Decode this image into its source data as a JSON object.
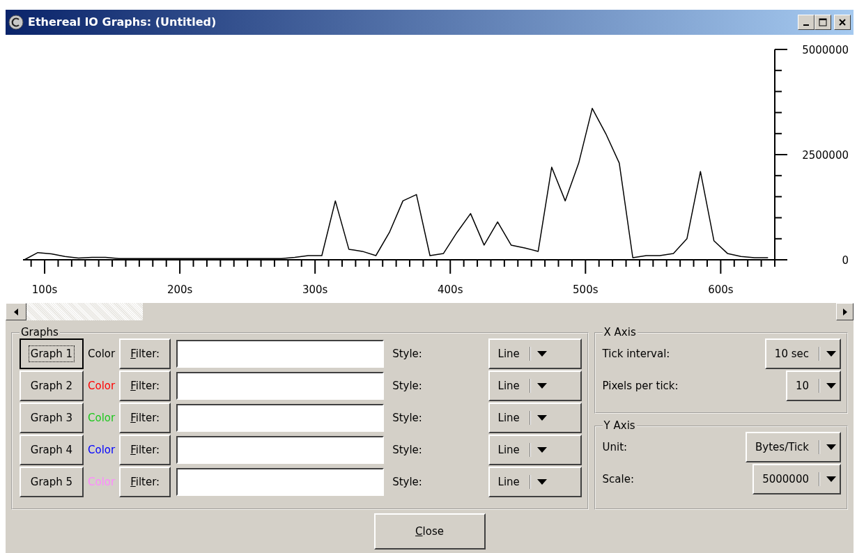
{
  "window": {
    "title": "Ethereal IO Graphs: (Untitled)"
  },
  "chart": {
    "chart_data": {
      "type": "line",
      "xlim": [
        84,
        640
      ],
      "ylim": [
        0,
        5000000
      ],
      "xticks": [
        {
          "value": 100,
          "label": "100s"
        },
        {
          "value": 200,
          "label": "200s"
        },
        {
          "value": 300,
          "label": "300s"
        },
        {
          "value": 400,
          "label": "400s"
        },
        {
          "value": 500,
          "label": "500s"
        },
        {
          "value": 600,
          "label": "600s"
        }
      ],
      "yticks": [
        {
          "value": 0,
          "label": "0"
        },
        {
          "value": 2500000,
          "label": "2500000"
        },
        {
          "value": 5000000,
          "label": "5000000"
        }
      ],
      "x": [
        85,
        95,
        105,
        115,
        125,
        135,
        145,
        155,
        165,
        175,
        185,
        195,
        205,
        215,
        225,
        235,
        245,
        255,
        265,
        275,
        285,
        295,
        305,
        315,
        325,
        335,
        345,
        355,
        365,
        375,
        385,
        395,
        405,
        415,
        425,
        435,
        445,
        455,
        465,
        475,
        485,
        495,
        505,
        515,
        525,
        535,
        545,
        555,
        565,
        575,
        585,
        595,
        605,
        615,
        625,
        635
      ],
      "series": [
        {
          "color": "#000000",
          "values": [
            0,
            170000,
            140000,
            80000,
            40000,
            60000,
            60000,
            30000,
            30000,
            30000,
            30000,
            30000,
            30000,
            30000,
            30000,
            30000,
            30000,
            30000,
            30000,
            30000,
            60000,
            100000,
            100000,
            1400000,
            250000,
            200000,
            100000,
            650000,
            1400000,
            1550000,
            100000,
            150000,
            650000,
            1100000,
            350000,
            900000,
            350000,
            280000,
            200000,
            2200000,
            1400000,
            2300000,
            3600000,
            3000000,
            2300000,
            50000,
            100000,
            100000,
            150000,
            500000,
            2100000,
            450000,
            150000,
            80000,
            50000,
            50000
          ]
        }
      ]
    }
  },
  "graphs": {
    "title": "Graphs",
    "rows": [
      {
        "button": "Graph 1",
        "focused": true,
        "color_label": "Color",
        "color": "#000000",
        "filter_button": "Filter:",
        "style_label": "Style:",
        "style": "Line"
      },
      {
        "button": "Graph 2",
        "focused": false,
        "color_label": "Color",
        "color": "#ff0000",
        "filter_button": "Filter:",
        "style_label": "Style:",
        "style": "Line"
      },
      {
        "button": "Graph 3",
        "focused": false,
        "color_label": "Color",
        "color": "#1cc81c",
        "filter_button": "Filter:",
        "style_label": "Style:",
        "style": "Line"
      },
      {
        "button": "Graph 4",
        "focused": false,
        "color_label": "Color",
        "color": "#0000ff",
        "filter_button": "Filter:",
        "style_label": "Style:",
        "style": "Line"
      },
      {
        "button": "Graph 5",
        "focused": false,
        "color_label": "Color",
        "color": "#ff88ff",
        "filter_button": "Filter:",
        "style_label": "Style:",
        "style": "Line"
      }
    ]
  },
  "x_axis": {
    "title": "X Axis",
    "fields": [
      {
        "label": "Tick interval:",
        "value": "10 sec"
      },
      {
        "label": "Pixels per tick:",
        "value": "10"
      }
    ]
  },
  "y_axis": {
    "title": "Y Axis",
    "fields": [
      {
        "label": "Unit:",
        "value": "Bytes/Tick"
      },
      {
        "label": "Scale:",
        "value": "5000000"
      }
    ]
  },
  "close_button": "Close"
}
